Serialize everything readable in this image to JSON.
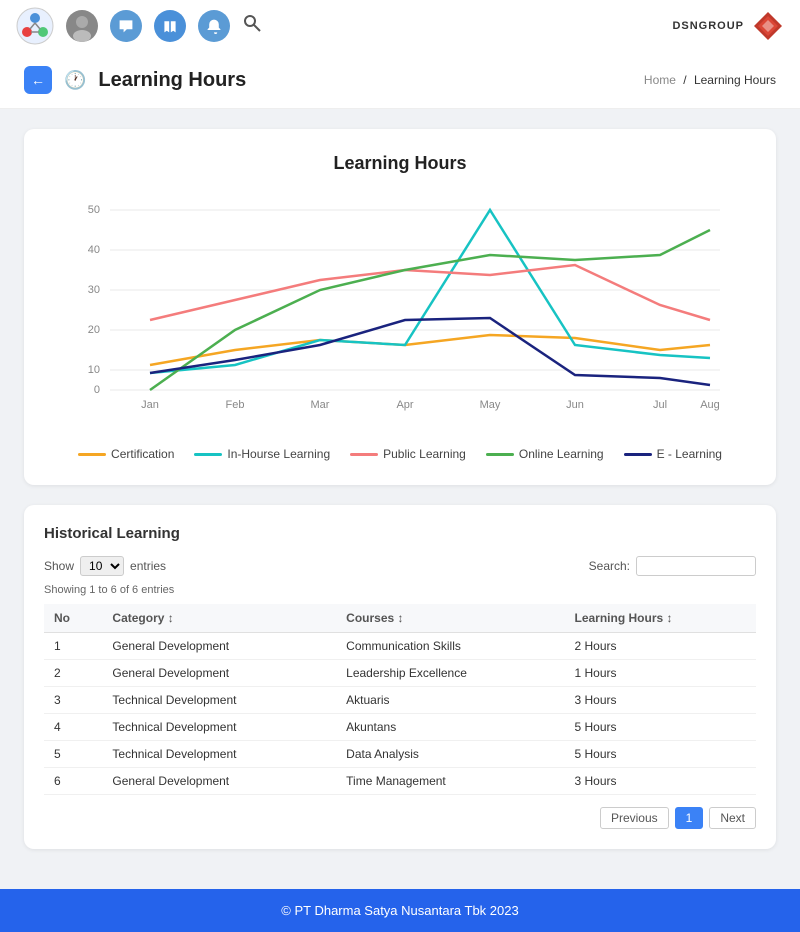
{
  "nav": {
    "icons": [
      "person",
      "chat",
      "book",
      "bell",
      "search"
    ],
    "brand": "DSNGROUP"
  },
  "header": {
    "back_label": "←",
    "title": "Learning Hours",
    "breadcrumb_home": "Home",
    "breadcrumb_current": "Learning Hours"
  },
  "chart": {
    "title": "Learning Hours",
    "legend": [
      {
        "label": "Certification",
        "color": "#f5a623"
      },
      {
        "label": "In-Hourse Learning",
        "color": "#17c3c3"
      },
      {
        "label": "Public Learning",
        "color": "#f47c7c"
      },
      {
        "label": "Online Learning",
        "color": "#4caf50"
      },
      {
        "label": "E - Learning",
        "color": "#1a237e"
      }
    ],
    "xLabels": [
      "Jan",
      "Feb",
      "Mar",
      "Apr",
      "May",
      "Jun",
      "Jul",
      "Aug"
    ],
    "yLabels": [
      "0",
      "10",
      "20",
      "30",
      "40",
      "50"
    ]
  },
  "historical": {
    "section_title": "Historical Learning",
    "show_label": "Show",
    "entries_label": "entries",
    "showing_text": "Showing 1 to 6 of 6 entries",
    "search_label": "Search:",
    "columns": [
      "No",
      "Category",
      "Courses",
      "Learning Hours"
    ],
    "rows": [
      {
        "no": "1",
        "category": "General Development",
        "courses": "Communication Skills",
        "hours": "2 Hours"
      },
      {
        "no": "2",
        "category": "General Development",
        "courses": "Leadership Excellence",
        "hours": "1 Hours"
      },
      {
        "no": "3",
        "category": "Technical Development",
        "courses": "Aktuaris",
        "hours": "3 Hours"
      },
      {
        "no": "4",
        "category": "Technical Development",
        "courses": "Akuntans",
        "hours": "5 Hours"
      },
      {
        "no": "5",
        "category": "Technical Development",
        "courses": "Data Analysis",
        "hours": "5 Hours"
      },
      {
        "no": "6",
        "category": "General Development",
        "courses": "Time Management",
        "hours": "3 Hours"
      }
    ],
    "pagination": {
      "prev_label": "Previous",
      "next_label": "Next",
      "current_page": "1"
    }
  },
  "footer": {
    "text": "© PT Dharma Satya Nusantara Tbk 2023"
  }
}
